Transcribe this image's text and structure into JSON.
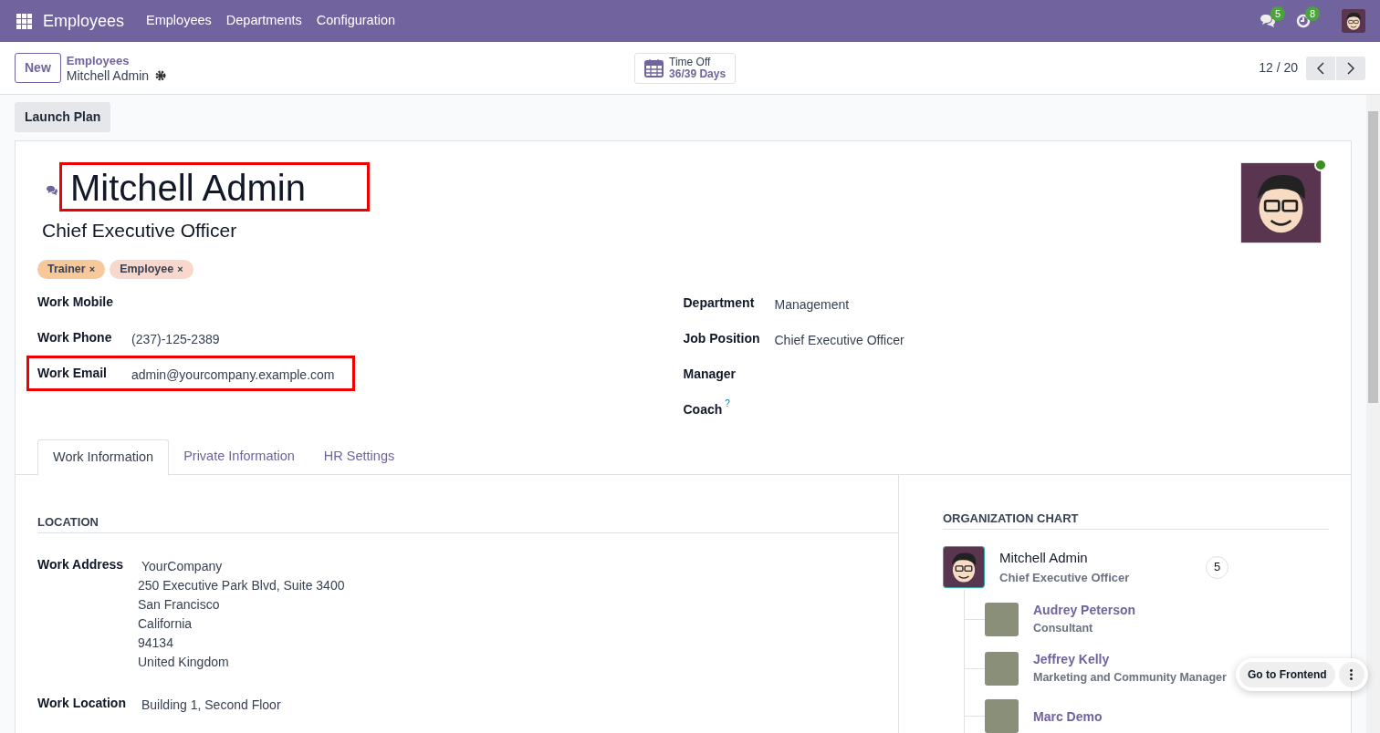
{
  "navbar": {
    "app_name": "Employees",
    "menu": [
      "Employees",
      "Departments",
      "Configuration"
    ],
    "messages_badge": "5",
    "activities_badge": "8"
  },
  "control_panel": {
    "new_button": "New",
    "breadcrumb_parent": "Employees",
    "breadcrumb_current": "Mitchell Admin",
    "time_off": {
      "label": "Time Off",
      "value": "36/39 Days"
    },
    "pager": "12 / 20"
  },
  "actions": [
    "Launch Plan"
  ],
  "employee": {
    "name": "Mitchell Admin",
    "name_highlighted": true,
    "online": true,
    "job_title": "Chief Executive Officer",
    "tags": [
      {
        "label": "Trainer",
        "remove": "×",
        "color": "#f6c89a"
      },
      {
        "label": "Employee",
        "remove": "×",
        "color": "#f8d7cd"
      }
    ],
    "left_fields": [
      {
        "label": "Work Mobile",
        "highlighted": false
      },
      {
        "label": "Work Phone",
        "value": "(237)-125-2389",
        "highlighted": false
      },
      {
        "label": "Work Email",
        "value": "admin@yourcompany.example.com",
        "highlighted": true
      }
    ],
    "right_fields": [
      {
        "label": "Department",
        "value": "Management"
      },
      {
        "label": "Job Position",
        "value": "Chief Executive Officer"
      },
      {
        "label": "Manager"
      },
      {
        "label": "Coach",
        "help": "?"
      }
    ]
  },
  "tabs": [
    {
      "label": "Work Information",
      "selected": true
    },
    {
      "label": "Private Information",
      "selected": false
    },
    {
      "label": "HR Settings",
      "selected": false
    }
  ],
  "location": {
    "title": "LOCATION",
    "fields": [
      {
        "label": "Work Address",
        "value": "YourCompany",
        "address_lines": [
          "250 Executive Park Blvd, Suite 3400",
          "San Francisco",
          "California",
          "94134",
          "United Kingdom"
        ]
      },
      {
        "label": "Work Location",
        "value": "Building 1, Second Floor"
      }
    ]
  },
  "org_chart": {
    "title": "ORGANIZATION CHART",
    "manager": {
      "name": "Mitchell Admin",
      "job": "Chief Executive Officer",
      "count": "5"
    },
    "children": [
      {
        "name": "Audrey Peterson",
        "job": "Consultant"
      },
      {
        "name": "Jeffrey Kelly",
        "job": "Marketing and Community Manager"
      },
      {
        "name": "Marc Demo"
      }
    ]
  },
  "floating": {
    "button": "Go to Frontend"
  }
}
